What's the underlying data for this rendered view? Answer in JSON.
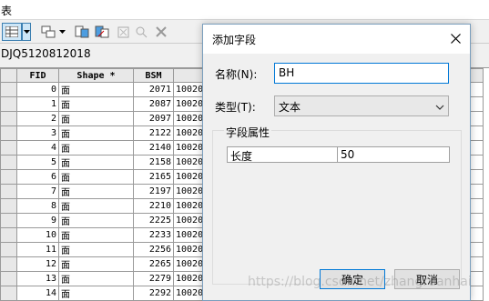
{
  "window": {
    "title": "表"
  },
  "layer": {
    "name": "DJQ5120812018"
  },
  "table": {
    "headers": [
      "FID",
      "Shape *",
      "BSM",
      ""
    ],
    "rows": [
      {
        "fid": "0",
        "shape": "面",
        "bsm": "2071",
        "next": "10020"
      },
      {
        "fid": "1",
        "shape": "面",
        "bsm": "2087",
        "next": "10020"
      },
      {
        "fid": "2",
        "shape": "面",
        "bsm": "2097",
        "next": "10020"
      },
      {
        "fid": "3",
        "shape": "面",
        "bsm": "2122",
        "next": "10020"
      },
      {
        "fid": "4",
        "shape": "面",
        "bsm": "2140",
        "next": "10020"
      },
      {
        "fid": "5",
        "shape": "面",
        "bsm": "2158",
        "next": "10020"
      },
      {
        "fid": "6",
        "shape": "面",
        "bsm": "2165",
        "next": "10020"
      },
      {
        "fid": "7",
        "shape": "面",
        "bsm": "2197",
        "next": "10020"
      },
      {
        "fid": "8",
        "shape": "面",
        "bsm": "2210",
        "next": "10020"
      },
      {
        "fid": "9",
        "shape": "面",
        "bsm": "2225",
        "next": "10020"
      },
      {
        "fid": "10",
        "shape": "面",
        "bsm": "2233",
        "next": "10020"
      },
      {
        "fid": "11",
        "shape": "面",
        "bsm": "2256",
        "next": "10020"
      },
      {
        "fid": "12",
        "shape": "面",
        "bsm": "2265",
        "next": "10020"
      },
      {
        "fid": "13",
        "shape": "面",
        "bsm": "2279",
        "next": "10020"
      },
      {
        "fid": "14",
        "shape": "面",
        "bsm": "2292",
        "next": "10020"
      },
      {
        "fid": "15",
        "shape": "面",
        "bsm": "2306",
        "next": "10020"
      }
    ]
  },
  "dialog": {
    "title": "添加字段",
    "name_label": "名称(N):",
    "name_value": "BH",
    "type_label": "类型(T):",
    "type_value": "文本",
    "group_title": "字段属性",
    "prop_name": "长度",
    "prop_value": "50",
    "ok_label": "确定",
    "cancel_label": "取消"
  },
  "watermark": "https://blog.csdn.net/zhangruanhai"
}
